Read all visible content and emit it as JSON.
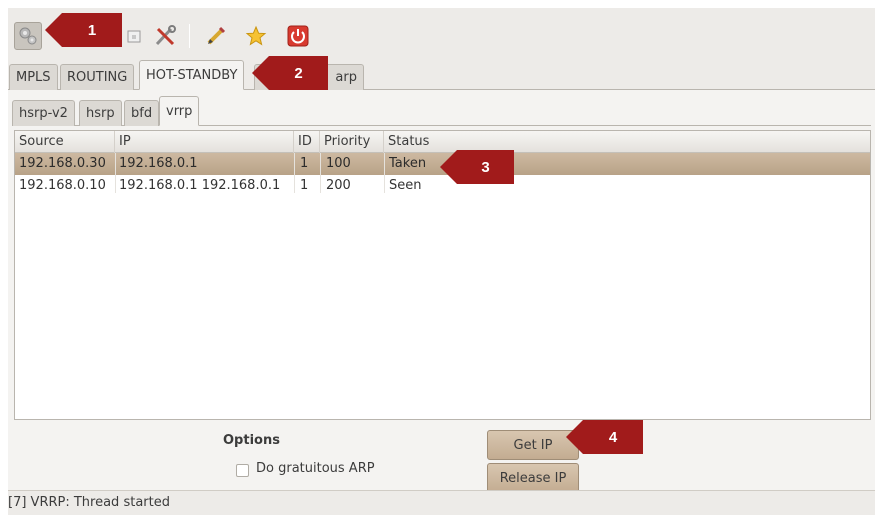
{
  "toolbar": {
    "icons": [
      "settings-gears-icon",
      "window-icon",
      "tools-icon",
      "pencil-icon",
      "star-icon",
      "power-icon"
    ]
  },
  "tabs": [
    "MPLS",
    "ROUTING",
    "HOT-STANDBY",
    "arp"
  ],
  "active_tab": "HOT-STANDBY",
  "subtabs": [
    "hsrp-v2",
    "hsrp",
    "bfd",
    "vrrp"
  ],
  "active_subtab": "vrrp",
  "table": {
    "columns": [
      "Source",
      "IP",
      "ID",
      "Priority",
      "Status"
    ],
    "rows": [
      {
        "source": "192.168.0.30",
        "ip": "192.168.0.1",
        "id": "1",
        "priority": "100",
        "status": "Taken",
        "selected": true
      },
      {
        "source": "192.168.0.10",
        "ip": "192.168.0.1 192.168.0.1",
        "id": "1",
        "priority": "200",
        "status": "Seen",
        "selected": false
      }
    ]
  },
  "options": {
    "title": "Options",
    "gratuitous_arp_label": "Do gratuitous ARP",
    "gratuitous_arp_checked": false
  },
  "buttons": {
    "get_ip": "Get IP",
    "release_ip": "Release IP"
  },
  "status": "[7] VRRP: Thread started",
  "callouts": [
    "1",
    "2",
    "3",
    "4"
  ],
  "colors": {
    "callout": "#a11b1b",
    "selection": "#c4ae94",
    "window_bg": "#edebe8"
  }
}
